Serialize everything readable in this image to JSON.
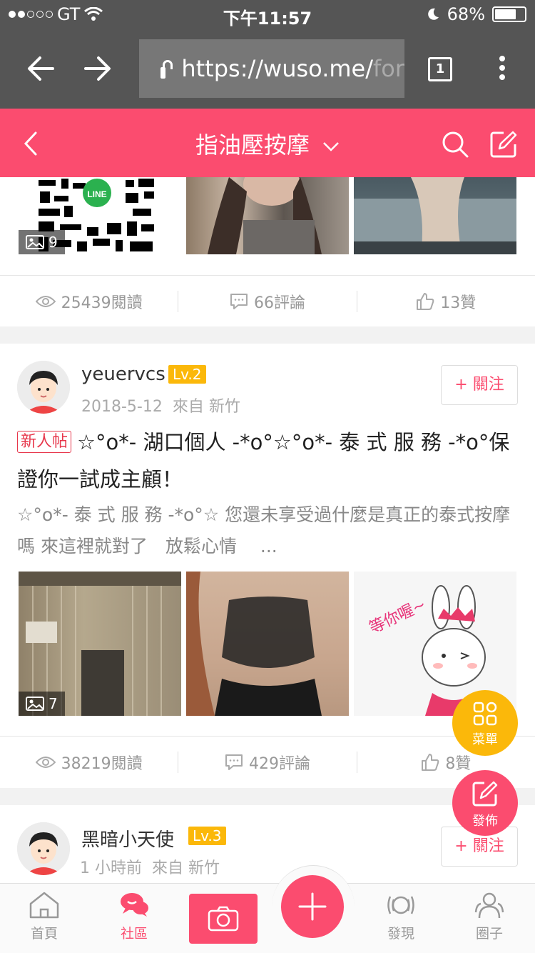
{
  "status_bar": {
    "carrier": "GT",
    "time": "下午11:57",
    "battery": "68%",
    "signal_bars": 2
  },
  "browser": {
    "url_visible": "https://wuso.me/",
    "url_faded": "for",
    "tab_count": "1"
  },
  "app_bar": {
    "title": "指油壓按摩"
  },
  "posts": [
    {
      "image_count": "9",
      "views": "25439閱讀",
      "comments": "66評論",
      "likes": "13贊"
    },
    {
      "username": "yeuervcs",
      "level": "Lv.2",
      "date": "2018-5-12",
      "location": "來自 新竹",
      "follow_label": "+ 關注",
      "new_tag": "新人帖",
      "title": "☆°o*- 湖口個人 -*o°☆°o*- 泰 式 服 務 -*o°保證你一試成主顧！",
      "excerpt": "☆°o*- 泰 式 服 務 -*o°☆ 您還未享受過什麼是真正的泰式按摩嗎 來這裡就對了　放鬆心情　 ...",
      "image_count": "7",
      "sticker_text": "等你喔~",
      "views": "38219閱讀",
      "comments": "429評論",
      "likes": "8贊"
    },
    {
      "username": "黑暗小天使",
      "level": "Lv.3",
      "date": "1 小時前",
      "location": "來自 新竹",
      "follow_label": "+ 關注"
    }
  ],
  "fabs": {
    "menu_label": "菜單",
    "publish_label": "發佈"
  },
  "tabbar": {
    "home": "首頁",
    "community": "社區",
    "discover": "發現",
    "circle": "圈子"
  },
  "colors": {
    "brand": "#fb4c6f",
    "level_badge": "#fbb80a",
    "menu_fab": "#fbb80a"
  }
}
